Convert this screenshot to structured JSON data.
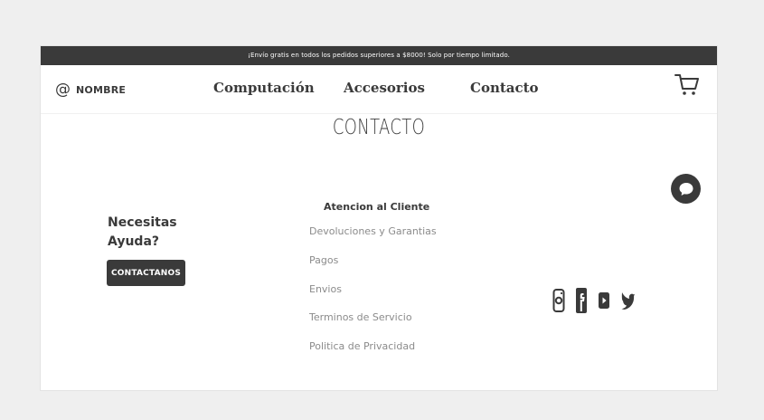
{
  "colors": {
    "page_background": "#efefef",
    "site_background": "#ffffff",
    "primary_dark": "#3a3a3a",
    "muted_text": "#8b8b8b",
    "promo_text": "#ffffff"
  },
  "promo": {
    "text": "¡Envío gratis en todos los pedidos superiores a $8000! Solo por tiempo limitado."
  },
  "header": {
    "brand": {
      "symbol": "@",
      "name": "NOMBRE"
    },
    "nav": [
      {
        "label": "Computación"
      },
      {
        "label": "Accesorios"
      },
      {
        "label": "Contacto"
      }
    ],
    "cart_icon": "shopping-cart-icon"
  },
  "main": {
    "title": "CONTACTO",
    "chat_icon": "chat-bubble-icon",
    "help": {
      "title": "Necesitas Ayuda?",
      "button_label": "CONTACTANOS"
    },
    "support": {
      "title": "Atencion al Cliente",
      "links": [
        {
          "label": "Devoluciones y Garantias"
        },
        {
          "label": "Pagos"
        },
        {
          "label": "Envios"
        },
        {
          "label": "Terminos de Servicio"
        },
        {
          "label": "Politica de Privacidad"
        }
      ]
    },
    "social": [
      {
        "icon": "instagram-icon"
      },
      {
        "icon": "facebook-icon"
      },
      {
        "icon": "youtube-icon"
      },
      {
        "icon": "twitter-icon"
      }
    ]
  }
}
